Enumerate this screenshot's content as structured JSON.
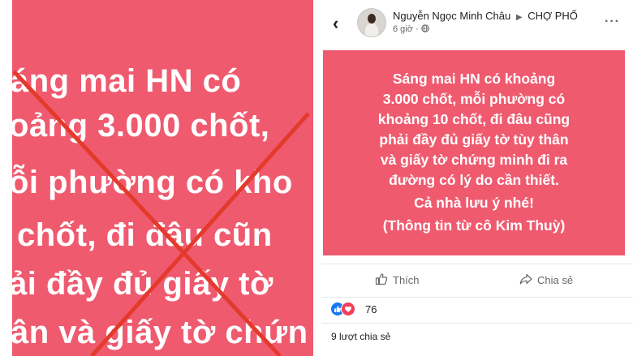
{
  "left_panel": {
    "lines": [
      "áng mai HN có",
      "oảng 3.000 chốt,",
      "ỗi phường có kho",
      "chốt, đi đâu cũn",
      "ải đầy đủ giấy tờ",
      "ân và giấy tờ chứn"
    ],
    "mark_color": "#e33a2c",
    "background": "#ef5a6f"
  },
  "post": {
    "back_icon": "chevron-left-icon",
    "author": "Nguyễn Ngọc Minh Châu",
    "group_arrow": "▶",
    "group": "CHỢ PHỐ",
    "time": "6 giờ ·",
    "privacy_icon": "globe-icon",
    "more": "···",
    "card_lines": [
      "Sáng mai HN có khoảng",
      "3.000 chốt, mỗi phường có",
      "khoảng 10 chốt, đi đâu cũng",
      "phải đầy đủ giấy tờ tùy thân",
      "và giấy tờ chứng minh đi ra",
      "đường có lý do cần thiết.",
      "Cả nhà lưu ý nhé!",
      "(Thông tin từ cô Kim Thuỳ)"
    ],
    "card_color": "#ef5a6f",
    "like_label": "Thích",
    "share_label": "Chia sẻ",
    "reaction_count": "76",
    "shares_text": "9 lượt chia sẻ"
  }
}
